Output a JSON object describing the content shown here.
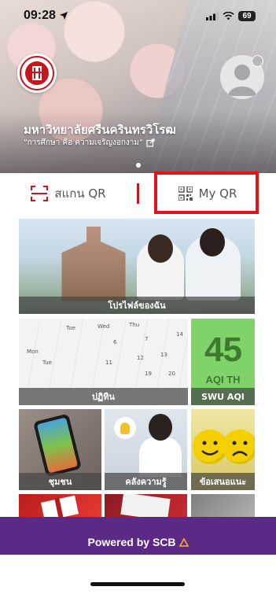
{
  "status_bar": {
    "time": "09:28",
    "battery": "69"
  },
  "header": {
    "university_name": "มหาวิทยาลัยศรีนครินทรวิโรฒ",
    "slogan": "\"การศึกษา คือ ความเจริญงอกงาม\""
  },
  "qr_actions": {
    "scan_label": "สแกน QR",
    "my_qr_label": "My QR"
  },
  "tiles": {
    "profile": "โปรไฟล์ของฉัน",
    "calendar": "ปฏิทิน",
    "aqi_label": "SWU AQI",
    "aqi_value": "45",
    "aqi_unit": "AQI TH",
    "community": "ชุมชน",
    "knowledge": "คลังความรู้",
    "feedback": "ข้อเสนอแนะ"
  },
  "footer": {
    "powered_by": "Powered by SCB"
  },
  "colors": {
    "accent_red": "#e3121b",
    "footer_purple": "#5b2a86",
    "aqi_green": "#7fd36a"
  },
  "icons": [
    "location-arrow-icon",
    "signal-icon",
    "wifi-icon",
    "battery-icon",
    "university-logo",
    "avatar-icon",
    "external-link-icon",
    "scan-qr-icon",
    "qr-code-icon",
    "scb-logo-icon"
  ]
}
